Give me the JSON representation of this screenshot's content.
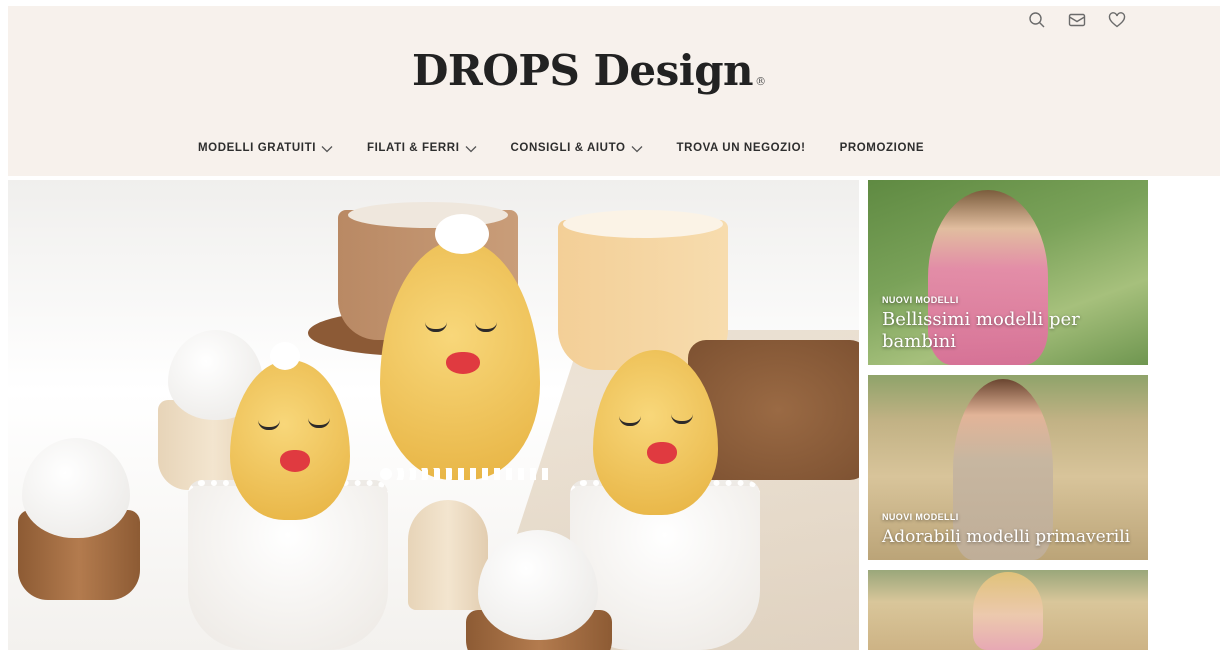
{
  "header": {
    "logo_text": "DROPS Design",
    "logo_mark": "®",
    "utility_icons": [
      "search-icon",
      "mail-icon",
      "heart-icon"
    ]
  },
  "nav": {
    "items": [
      {
        "label": "MODELLI GRATUITI",
        "dropdown": true
      },
      {
        "label": "FILATI & FERRI",
        "dropdown": true
      },
      {
        "label": "CONSIGLI & AIUTO",
        "dropdown": true
      },
      {
        "label": "TROVA UN NEGOZIO!",
        "dropdown": false
      },
      {
        "label": "PROMOZIONE",
        "dropdown": false
      }
    ]
  },
  "cards": [
    {
      "tag": "NUOVI MODELLI",
      "title": "Bellissimi modelli per bambini"
    },
    {
      "tag": "NUOVI MODELLI",
      "title": "Adorabili modelli primaverili"
    }
  ],
  "colors": {
    "header_bg": "#f7f1ec",
    "text": "#2b2b2b"
  }
}
